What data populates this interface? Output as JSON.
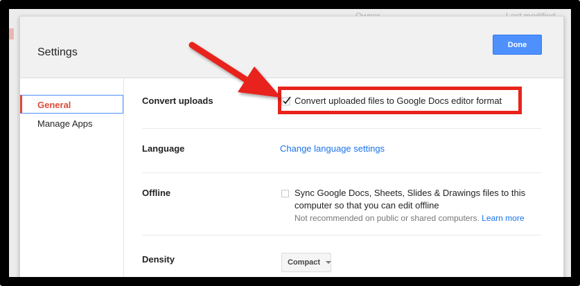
{
  "background": {
    "col_owner": "Owner",
    "col_last_modified": "Last modified"
  },
  "dialog": {
    "title": "Settings",
    "done_label": "Done"
  },
  "sidebar": {
    "items": [
      {
        "label": "General",
        "selected": true
      },
      {
        "label": "Manage Apps",
        "selected": false
      }
    ]
  },
  "settings": {
    "convert_uploads": {
      "label": "Convert uploads",
      "option": "Convert uploaded files to Google Docs editor format",
      "checked": true
    },
    "language": {
      "label": "Language",
      "link": "Change language settings"
    },
    "offline": {
      "label": "Offline",
      "option_line1": "Sync Google Docs, Sheets, Slides & Drawings files to this",
      "option_line2": "computer so that you can edit offline",
      "hint": "Not recommended on public or shared computers.",
      "learn_more": "Learn more",
      "checked": false
    },
    "density": {
      "label": "Density",
      "value": "Compact"
    }
  },
  "colors": {
    "accent_red": "#dd4b39",
    "done_blue": "#4d90fe",
    "annotation_red": "#e8231b",
    "link_blue": "#1a73e8"
  }
}
